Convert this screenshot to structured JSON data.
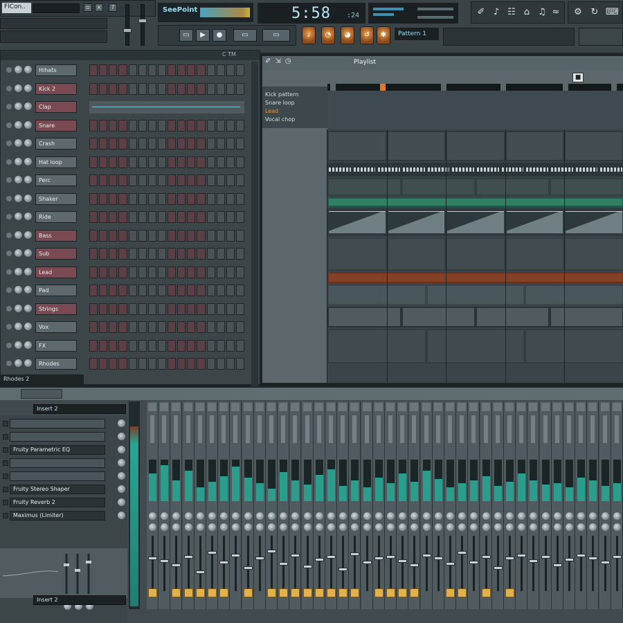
{
  "toolbar": {
    "project_name": "FlCon..",
    "song_title": "SeePoint",
    "time": "5:58",
    "time_ms": ":24",
    "pattern": "Pattern 1",
    "tools": [
      "✐",
      "♪",
      "☷",
      "⌂",
      "♫",
      "≈"
    ],
    "right_tools": [
      "⚙",
      "↻",
      "⌨"
    ]
  },
  "rack": {
    "header_label": "C  TM",
    "footer_label": "Rhodes 2",
    "channels": [
      {
        "name": "Hihats",
        "color": "grey"
      },
      {
        "name": "Kick 2",
        "color": "red"
      },
      {
        "name": "Clap",
        "color": "red"
      },
      {
        "name": "Snare",
        "color": "red"
      },
      {
        "name": "Crash",
        "color": "grey"
      },
      {
        "name": "Hat loop",
        "color": "grey"
      },
      {
        "name": "Perc",
        "color": "grey"
      },
      {
        "name": "Shaker",
        "color": "grey"
      },
      {
        "name": "Ride",
        "color": "grey"
      },
      {
        "name": "Bass",
        "color": "red"
      },
      {
        "name": "Sub",
        "color": "red"
      },
      {
        "name": "Lead",
        "color": "red"
      },
      {
        "name": "Pad",
        "color": "grey"
      },
      {
        "name": "Strings",
        "color": "red"
      },
      {
        "name": "Vox",
        "color": "grey"
      },
      {
        "name": "FX",
        "color": "grey"
      },
      {
        "name": "Rhodes",
        "color": "grey"
      }
    ]
  },
  "playlist": {
    "title": "Playlist",
    "tools": "✐⇲◷",
    "marker": "■",
    "tracks": [
      "Kick pattern",
      "Snare loop",
      "Lead",
      "Vocal chop"
    ]
  },
  "mixer": {
    "insert_name": "Insert 2",
    "footer_name": "Insert 2",
    "slots": [
      {
        "name": "",
        "filled": false
      },
      {
        "name": "",
        "filled": false
      },
      {
        "name": "Fruity Parametric EQ",
        "filled": true
      },
      {
        "name": "",
        "filled": false
      },
      {
        "name": "",
        "filled": false
      },
      {
        "name": "Fruity Stereo Shaper",
        "filled": true
      },
      {
        "name": "Fruity Reverb 2",
        "filled": true
      },
      {
        "name": "Maximus (Limiter)",
        "filled": true
      }
    ]
  },
  "colors": {
    "accent_cyan": "#9fdcf0",
    "pattern_red": "#7a4a52",
    "meter_teal": "#2a9d8c",
    "route_yellow": "#e2b14a",
    "highlight_orange": "#f09a3a"
  }
}
